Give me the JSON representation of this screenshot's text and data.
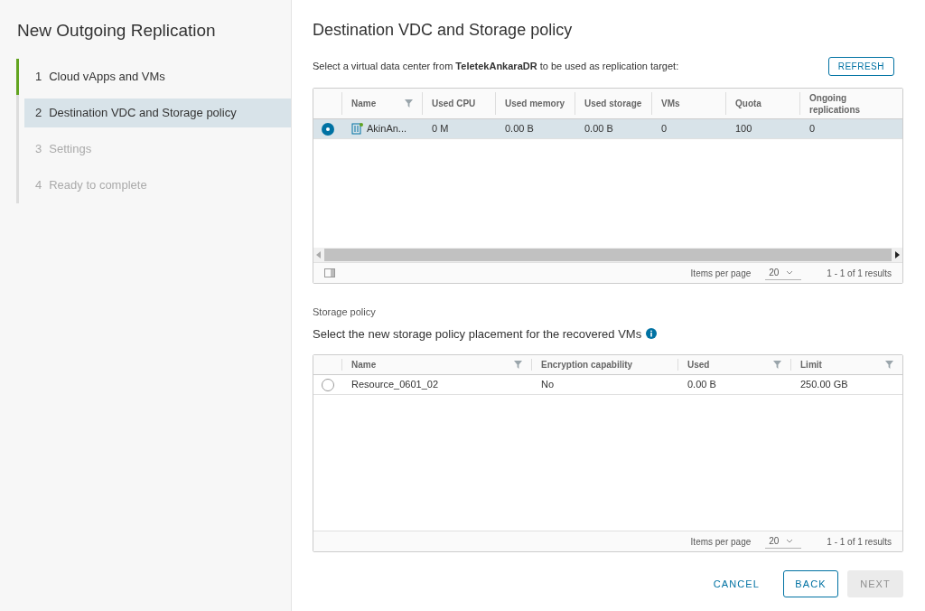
{
  "wizard": {
    "title": "New Outgoing Replication",
    "steps": [
      {
        "number": "1",
        "label": "Cloud vApps and VMs",
        "completed": true,
        "disabled": false,
        "selected": false
      },
      {
        "number": "2",
        "label": "Destination VDC and Storage policy",
        "completed": false,
        "disabled": false,
        "selected": true
      },
      {
        "number": "3",
        "label": "Settings",
        "completed": false,
        "disabled": true,
        "selected": false
      },
      {
        "number": "4",
        "label": "Ready to complete",
        "completed": false,
        "disabled": true,
        "selected": false
      }
    ]
  },
  "page_title": "Destination VDC and Storage policy",
  "intro": "Select a virtual data center from **TeletekAnkaraDR** to be used as replication target:",
  "refresh_button": "REFRESH",
  "vdc_table": {
    "columns": [
      {
        "label": "Name",
        "filter": true
      },
      {
        "label": "Used CPU",
        "filter": false
      },
      {
        "label": "Used memory",
        "filter": false
      },
      {
        "label": "Used storage",
        "filter": false
      },
      {
        "label": "VMs",
        "filter": false
      },
      {
        "label": "Quota",
        "filter": false
      },
      {
        "label": "Ongoing replications",
        "filter": false
      }
    ],
    "rows": [
      {
        "selected": true,
        "cells": [
          "AkinAn...",
          "0 M",
          "0.00 B",
          "0.00 B",
          "0",
          "100",
          "0"
        ]
      }
    ],
    "pagination": {
      "label": "Items per page",
      "per_page": "20",
      "range": "1 - 1 of 1 results"
    }
  },
  "storage_section": {
    "heading": "Storage policy",
    "description": "Select the new storage policy placement for the recovered VMs"
  },
  "storage_table": {
    "columns": [
      {
        "label": "Name",
        "filter": true
      },
      {
        "label": "Encryption capability",
        "filter": false
      },
      {
        "label": "Used",
        "filter": true
      },
      {
        "label": "Limit",
        "filter": true
      }
    ],
    "rows": [
      {
        "selected": false,
        "cells": [
          "Resource_0601_02",
          "No",
          "0.00 B",
          "250.00 GB"
        ]
      }
    ],
    "pagination": {
      "label": "Items per page",
      "per_page": "20",
      "range": "1 - 1 of 1 results"
    }
  },
  "footer_buttons": {
    "cancel": "CANCEL",
    "back": "BACK",
    "next": {
      "label": "NEXT",
      "disabled": true
    }
  }
}
